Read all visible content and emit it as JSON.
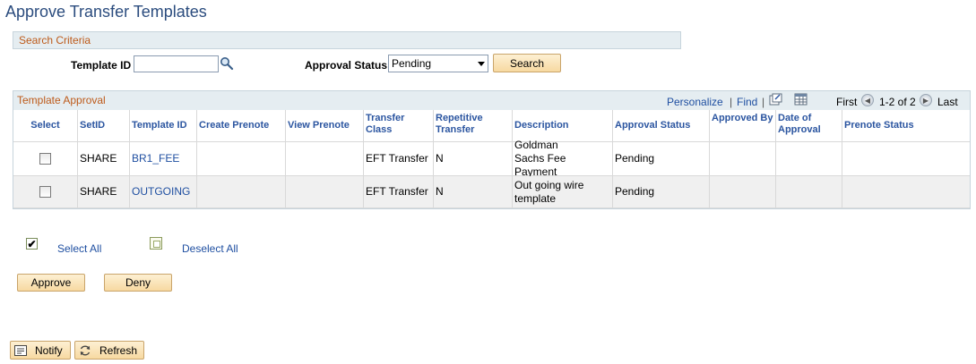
{
  "page": {
    "title": "Approve Transfer Templates"
  },
  "search": {
    "section_label": "Search Criteria",
    "template_id_label": "Template ID",
    "template_id_value": "",
    "approval_status_label": "Approval Status",
    "approval_status_value": "Pending",
    "search_button": "Search"
  },
  "grid": {
    "title": "Template Approval",
    "personalize_label": "Personalize",
    "find_label": "Find",
    "first_label": "First",
    "range_label": "1-2 of 2",
    "last_label": "Last",
    "columns": [
      "Select",
      "SetID",
      "Template ID",
      "Create Prenote",
      "View Prenote",
      "Transfer Class",
      "Repetitive Transfer",
      "Description",
      "Approval Status",
      "Approved By",
      "Date of Approval",
      "Prenote Status"
    ],
    "rows": [
      {
        "setid": "SHARE",
        "template_id": "BR1_FEE",
        "create_prenote": "",
        "view_prenote": "",
        "transfer_class": "EFT Transfer",
        "repetitive": "N",
        "description": "Goldman Sachs Fee Payment",
        "approval_status": "Pending",
        "approved_by": "",
        "date_of_approval": "",
        "prenote_status": ""
      },
      {
        "setid": "SHARE",
        "template_id": "OUTGOING",
        "create_prenote": "",
        "view_prenote": "",
        "transfer_class": "EFT Transfer",
        "repetitive": "N",
        "description": "Out going wire template",
        "approval_status": "Pending",
        "approved_by": "",
        "date_of_approval": "",
        "prenote_status": ""
      }
    ]
  },
  "actions": {
    "select_all": "Select All",
    "deselect_all": "Deselect All",
    "approve": "Approve",
    "deny": "Deny"
  },
  "footer": {
    "notify": "Notify",
    "refresh": "Refresh"
  },
  "icons": {
    "lookup": "magnifier-icon",
    "zoom": "view-all-icon",
    "download": "download-grid-icon",
    "prev": "previous-arrow-icon",
    "next": "next-arrow-icon",
    "notify": "notify-icon",
    "refresh": "refresh-icon"
  },
  "colors": {
    "title": "#2b4c7e",
    "section_label": "#bd5a1a",
    "link": "#1f4fa1",
    "header_bg": "#e5edf1",
    "button_bg": "#f7d9a1"
  }
}
